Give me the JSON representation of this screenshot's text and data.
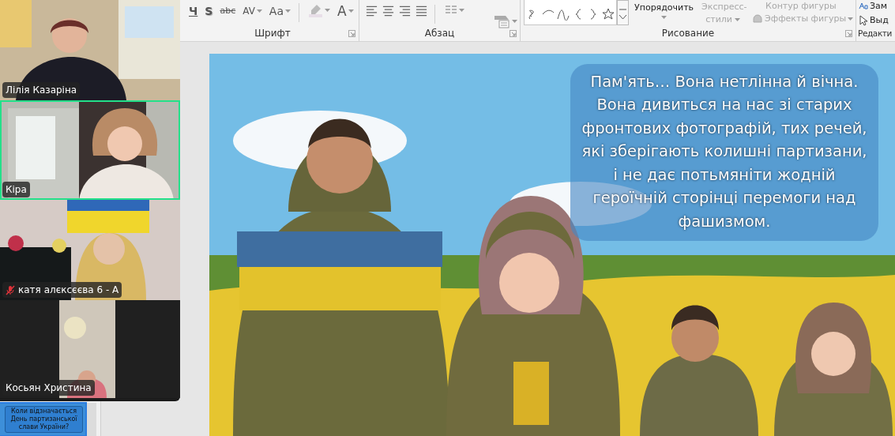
{
  "ribbon": {
    "groups": [
      {
        "kind": "font",
        "label": "Шрифт",
        "buttons": [
          {
            "text": "Ч",
            "kind": "underline"
          },
          {
            "text": "S",
            "kind": "shadow"
          },
          {
            "text": "abc",
            "kind": "strike"
          },
          {
            "text": "AV",
            "kind": "spacing"
          },
          {
            "text": "Aa",
            "kind": "case"
          },
          {
            "kind": "highlight"
          },
          {
            "text": "A",
            "kind": "color"
          }
        ]
      },
      {
        "kind": "paragraph",
        "label": "Абзац"
      },
      {
        "kind": "drawing",
        "label": "Рисование",
        "commands": [
          {
            "text": "Упорядочить",
            "kind": "arrange",
            "disabled": false
          },
          {
            "text": "Экспресс-стили",
            "kind": "styles",
            "disabled": true
          },
          {
            "text": "Контур фигуры",
            "kind": "outline",
            "disabled": true
          },
          {
            "text": "Эффекты фигуры",
            "kind": "effects",
            "disabled": true
          }
        ]
      },
      {
        "kind": "editing",
        "label": "Редакти",
        "commands": [
          {
            "text": "Зам",
            "kind": "replace",
            "disabled": false
          },
          {
            "text": "Выд",
            "kind": "select",
            "disabled": false
          }
        ]
      }
    ]
  },
  "participants": [
    {
      "name": "Лілія Казаріна",
      "speaking": false,
      "muted": false
    },
    {
      "name": "Кіра",
      "speaking": true,
      "muted": false
    },
    {
      "name": "катя алєксєєва 6 - А",
      "speaking": false,
      "muted": true
    },
    {
      "name": "Косьян Христина",
      "speaking": false,
      "muted": false
    }
  ],
  "thumbnails": [
    {
      "text": "Коли відзначається День партизанської слави України?",
      "selected": true
    }
  ],
  "slide": {
    "text_box": "Пам'ять… Вона нетлінна й вічна. Вона дивиться на нас зі старих фронтових фотографій, тих речей, які зберігають колишні партизани, і не дає потьмяніти жодній героїчній сторінці перемоги над фашизмом."
  }
}
